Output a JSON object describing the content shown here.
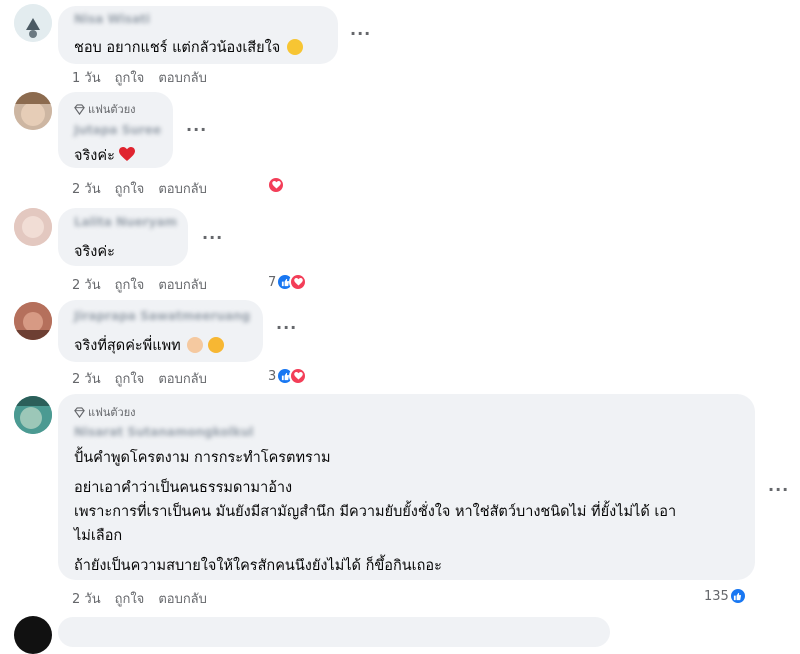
{
  "comments": [
    {
      "name": "Nisa Wisati",
      "text": "ชอบ อยากแชร์ แต่กลัวน้องเสียใจ",
      "time": "1 วัน",
      "like": "ถูกใจ",
      "reply": "ตอบกลับ",
      "emoji": "grinning-sweat-face"
    },
    {
      "badge": "แฟนตัวยง",
      "name": "Jutapa Suree",
      "text": "จริงค่ะ",
      "time": "2 วัน",
      "like": "ถูกใจ",
      "reply": "ตอบกลับ",
      "emoji": "red-heart",
      "reaction": "love-reaction"
    },
    {
      "name": "Lalita Nueryam",
      "text": "จริงค่ะ",
      "time": "2 วัน",
      "like": "ถูกใจ",
      "reply": "ตอบกลับ",
      "reaction_count": "7"
    },
    {
      "name": "Jiraprapa Sawatmeeruang",
      "text": "จริงที่สุดค่ะพี่แพท",
      "time": "2 วัน",
      "like": "ถูกใจ",
      "reply": "ตอบกลับ",
      "reaction_count": "3",
      "emoji": [
        "clapping-hands",
        "smiling-face-with-hearts"
      ]
    },
    {
      "badge": "แฟนตัวยง",
      "name": "Nisarat Sutanamongkolkul",
      "lines": [
        "ปั้นคำพูดโครตงาม การกระทำโครตทราม",
        "อย่าเอาคำว่าเป็นคนธรรมดามาอ้าง",
        "เพราะการที่เราเป็นคน มันยังมีสามัญสำนึก มีความยับยั้งชั่งใจ หาใช่สัตว์บางชนิดไม่ ที่ยั้งไม่ได้ เอา",
        "ไม่เลือก",
        "ถ้ายังเป็นความสบายใจให้ใครสักคนนึงยังไม่ได้ ก็ขึ้อกินเถอะ"
      ],
      "time": "2 วัน",
      "like": "ถูกใจ",
      "reply": "ตอบกลับ",
      "reaction_count": "135"
    }
  ],
  "more_label": "···",
  "colors": {
    "bubble": "#f0f2f5",
    "like": "#1877f2",
    "love": "#f33e58",
    "meta": "#65676b"
  }
}
